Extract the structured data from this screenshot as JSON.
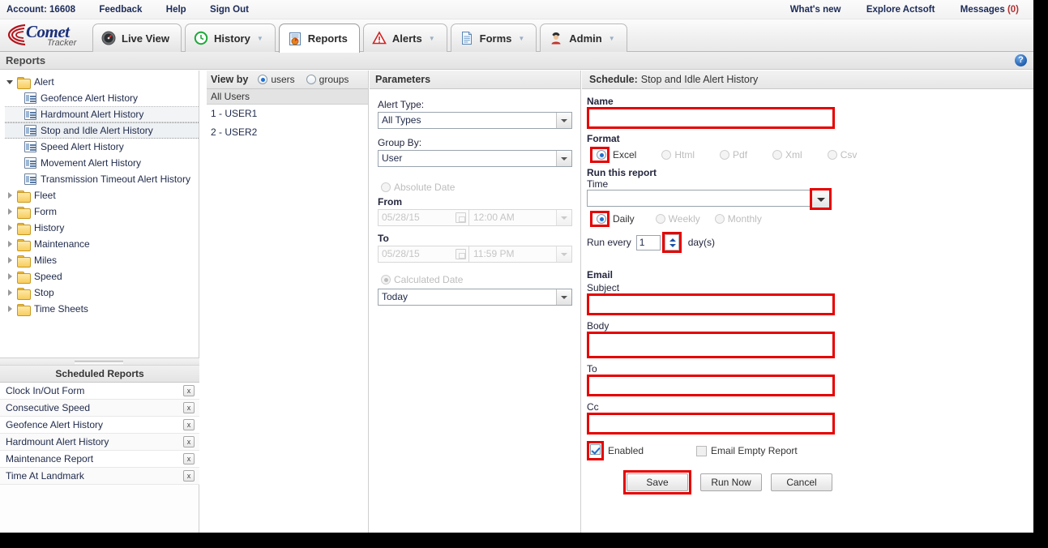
{
  "topbar": {
    "left_links": [
      {
        "label": "Account: 16608",
        "name": "account-label"
      },
      {
        "label": "Feedback",
        "name": "feedback-link"
      },
      {
        "label": "Help",
        "name": "help-link"
      },
      {
        "label": "Sign Out",
        "name": "sign-out-link"
      }
    ],
    "right_links": [
      {
        "label": "What's new",
        "name": "whats-new-link"
      },
      {
        "label": "Explore Actsoft",
        "name": "explore-actsoft-link"
      }
    ],
    "messages_label": "Messages",
    "messages_count": "(0)"
  },
  "logo": {
    "primary": "Comet",
    "secondary": "Tracker"
  },
  "tabs": [
    {
      "label": "Live View",
      "icon": "gauge-icon",
      "caret": false,
      "active": false
    },
    {
      "label": "History",
      "icon": "clock-icon",
      "caret": true,
      "active": false
    },
    {
      "label": "Reports",
      "icon": "report-chart-icon",
      "caret": false,
      "active": true
    },
    {
      "label": "Alerts",
      "icon": "warning-triangle-icon",
      "caret": true,
      "active": false
    },
    {
      "label": "Forms",
      "icon": "document-icon",
      "caret": true,
      "active": false
    },
    {
      "label": "Admin",
      "icon": "user-admin-icon",
      "caret": true,
      "active": false
    }
  ],
  "section": {
    "title": "Reports",
    "help_glyph": "?"
  },
  "tree": [
    {
      "label": "Alert",
      "type": "folder",
      "expanded": true,
      "depth": 0
    },
    {
      "label": "Geofence Alert History",
      "type": "report",
      "depth": 1
    },
    {
      "label": "Hardmount Alert History",
      "type": "report",
      "depth": 1,
      "state": "hover"
    },
    {
      "label": "Stop and Idle Alert History",
      "type": "report",
      "depth": 1,
      "state": "selected"
    },
    {
      "label": "Speed Alert History",
      "type": "report",
      "depth": 1
    },
    {
      "label": "Movement Alert History",
      "type": "report",
      "depth": 1
    },
    {
      "label": "Transmission Timeout Alert History",
      "type": "report",
      "depth": 1
    },
    {
      "label": "Fleet",
      "type": "folder",
      "expanded": false,
      "depth": 0
    },
    {
      "label": "Form",
      "type": "folder",
      "expanded": false,
      "depth": 0
    },
    {
      "label": "History",
      "type": "folder",
      "expanded": false,
      "depth": 0
    },
    {
      "label": "Maintenance",
      "type": "folder",
      "expanded": false,
      "depth": 0
    },
    {
      "label": "Miles",
      "type": "folder",
      "expanded": false,
      "depth": 0
    },
    {
      "label": "Speed",
      "type": "folder",
      "expanded": false,
      "depth": 0
    },
    {
      "label": "Stop",
      "type": "folder",
      "expanded": false,
      "depth": 0
    },
    {
      "label": "Time Sheets",
      "type": "folder",
      "expanded": false,
      "depth": 0
    }
  ],
  "scheduled_reports": {
    "title": "Scheduled Reports",
    "delete_glyph": "x",
    "items": [
      {
        "label": "Clock In/Out Form"
      },
      {
        "label": "Consecutive Speed"
      },
      {
        "label": "Geofence Alert History"
      },
      {
        "label": "Hardmount Alert History"
      },
      {
        "label": "Maintenance Report"
      },
      {
        "label": "Time At Landmark"
      }
    ]
  },
  "viewby": {
    "label": "View by",
    "options": [
      {
        "label": "users",
        "checked": true
      },
      {
        "label": "groups",
        "checked": false
      }
    ],
    "all_users_label": "All Users",
    "users": [
      {
        "label": "1 - USER1"
      },
      {
        "label": "2 - USER2"
      }
    ]
  },
  "parameters": {
    "title": "Parameters",
    "alert_type_label": "Alert Type:",
    "alert_type_value": "All Types",
    "group_by_label": "Group By:",
    "group_by_value": "User",
    "absolute_date_label": "Absolute Date",
    "absolute_date_checked": false,
    "from_label": "From",
    "from_date": "05/28/15",
    "from_time": "12:00 AM",
    "to_label": "To",
    "to_date": "05/28/15",
    "to_time": "11:59 PM",
    "calculated_date_label": "Calculated Date",
    "calculated_date_checked": true,
    "calculated_value": "Today"
  },
  "schedule": {
    "title_prefix": "Schedule:",
    "title_value": "Stop and Idle Alert History",
    "name_label": "Name",
    "name_value": "",
    "format_label": "Format",
    "formats": [
      {
        "label": "Excel",
        "checked": true,
        "disabled": false,
        "highlight": true
      },
      {
        "label": "Html",
        "checked": false,
        "disabled": true,
        "highlight": false
      },
      {
        "label": "Pdf",
        "checked": false,
        "disabled": true,
        "highlight": false
      },
      {
        "label": "Xml",
        "checked": false,
        "disabled": true,
        "highlight": false
      },
      {
        "label": "Csv",
        "checked": false,
        "disabled": true,
        "highlight": false
      }
    ],
    "run_report_label": "Run this report",
    "time_label": "Time",
    "time_value": "",
    "frequencies": [
      {
        "label": "Daily",
        "checked": true,
        "disabled": false,
        "highlight": true
      },
      {
        "label": "Weekly",
        "checked": false,
        "disabled": true,
        "highlight": false
      },
      {
        "label": "Monthly",
        "checked": false,
        "disabled": true,
        "highlight": false
      }
    ],
    "run_every_label": "Run every",
    "run_every_value": "1",
    "run_every_unit": "day(s)",
    "email_label": "Email",
    "subject_label": "Subject",
    "subject_value": "",
    "body_label": "Body",
    "body_value": "",
    "to_label": "To",
    "to_value": "",
    "cc_label": "Cc",
    "cc_value": "",
    "enabled_label": "Enabled",
    "enabled_checked": true,
    "empty_report_label": "Email Empty Report",
    "empty_report_checked": false,
    "buttons": [
      {
        "label": "Save",
        "highlight": true
      },
      {
        "label": "Run Now",
        "highlight": false
      },
      {
        "label": "Cancel",
        "highlight": false
      }
    ]
  },
  "colors": {
    "highlight": "#e60000",
    "brand": "#1b2f7a",
    "link": "#1b2a57",
    "accent_radio": "#1f6fd0"
  }
}
